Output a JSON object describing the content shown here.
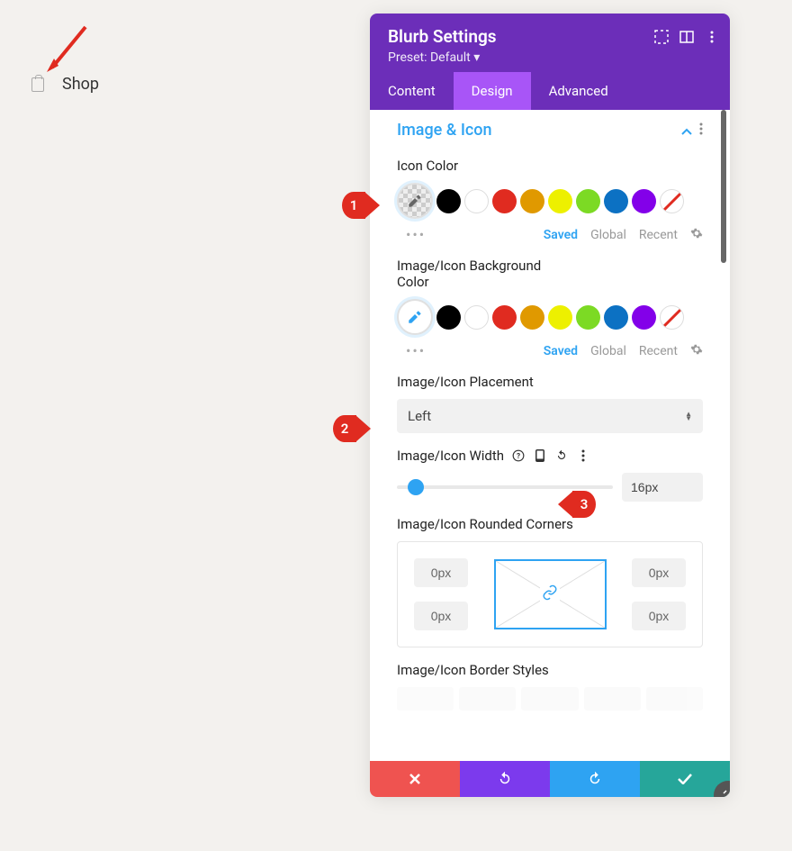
{
  "shop": {
    "label": "Shop"
  },
  "panel": {
    "title": "Blurb Settings",
    "preset": "Preset: Default ▾",
    "tabs": [
      "Content",
      "Design",
      "Advanced"
    ],
    "activeTab": 1
  },
  "section": {
    "title": "Image & Icon"
  },
  "iconColor": {
    "label": "Icon Color",
    "paletteTabs": {
      "saved": "Saved",
      "global": "Global",
      "recent": "Recent"
    }
  },
  "bgColor": {
    "label": "Image/Icon Background Color",
    "paletteTabs": {
      "saved": "Saved",
      "global": "Global",
      "recent": "Recent"
    }
  },
  "placement": {
    "label": "Image/Icon Placement",
    "value": "Left"
  },
  "width": {
    "label": "Image/Icon Width",
    "value": "16px"
  },
  "corners": {
    "label": "Image/Icon Rounded Corners",
    "tl": "0px",
    "tr": "0px",
    "bl": "0px",
    "br": "0px"
  },
  "border": {
    "label": "Image/Icon Border Styles"
  },
  "annotations": {
    "p1": "1",
    "p2": "2",
    "p3": "3"
  },
  "swatchColors": [
    "black",
    "white",
    "red",
    "orange",
    "yellow",
    "green",
    "blue",
    "purple",
    "none"
  ]
}
